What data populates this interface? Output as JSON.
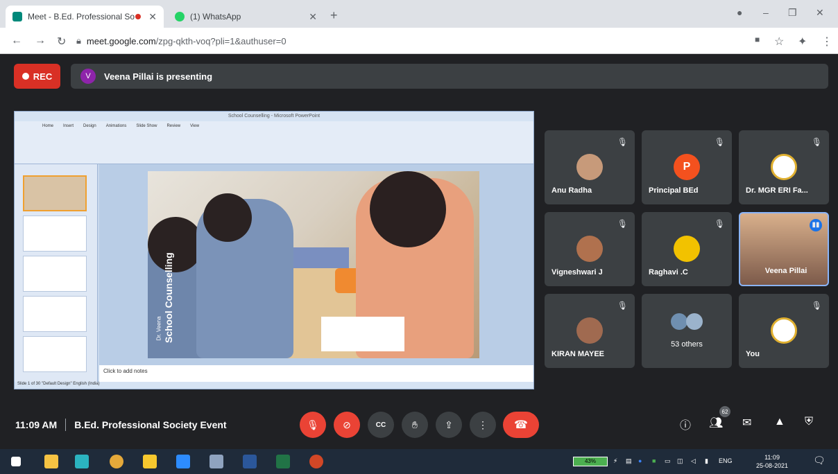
{
  "browser": {
    "tabs": [
      {
        "title": "Meet - B.Ed. Professional So",
        "color": "#00897b"
      },
      {
        "title": "(1) WhatsApp",
        "color": "#25d366"
      }
    ],
    "url_host": "meet.google.com",
    "url_path": "/zpg-qkth-voq?pli=1&authuser=0"
  },
  "meeting": {
    "rec_label": "REC",
    "presenter_initial": "V",
    "presenting_text": "Veena Pillai is presenting",
    "time": "11:09 AM",
    "event_name": "B.Ed. Professional Society Event",
    "participant_count": "62"
  },
  "slide": {
    "app_title": "School Counselling - Microsoft PowerPoint",
    "ribbon_tabs": [
      "Home",
      "Insert",
      "Design",
      "Animations",
      "Slide Show",
      "Review",
      "View"
    ],
    "watermark_title": "School Counselling",
    "watermark_author": "Dr. Veena",
    "notes_placeholder": "Click to add notes",
    "status_text": "Slide 1 of 30   \"Default Design\"   English (India)"
  },
  "participants": [
    {
      "name": "Anu Radha",
      "avatar": "photo",
      "color": "#c79a7a"
    },
    {
      "name": "Principal BEd",
      "avatar": "P",
      "color": "#f4511e"
    },
    {
      "name": "Dr. MGR ERI Fa...",
      "avatar": "logo",
      "color": "#ffffff"
    },
    {
      "name": "Vigneshwari J",
      "avatar": "photo",
      "color": "#b0714e"
    },
    {
      "name": "Raghavi .C",
      "avatar": "photo",
      "color": "#f2c200"
    },
    {
      "name": "Veena Pillai",
      "avatar": "video",
      "color": "#7c5a4a"
    },
    {
      "name": "KIRAN MAYEE",
      "avatar": "photo",
      "color": "#a06a50"
    },
    {
      "name": "53 others",
      "avatar": "group",
      "color": "#6f8fb0"
    },
    {
      "name": "You",
      "avatar": "logo",
      "color": "#ffffff"
    }
  ],
  "controls": {
    "mic": "mic-off-icon",
    "camera": "camera-off-icon",
    "captions": "CC",
    "hand": "raise-hand-icon",
    "present": "present-icon",
    "more": "more-icon",
    "end": "end-call-icon"
  },
  "taskbar": {
    "battery": "43%",
    "lang": "ENG",
    "time": "11:09",
    "date": "25-08-2021"
  }
}
